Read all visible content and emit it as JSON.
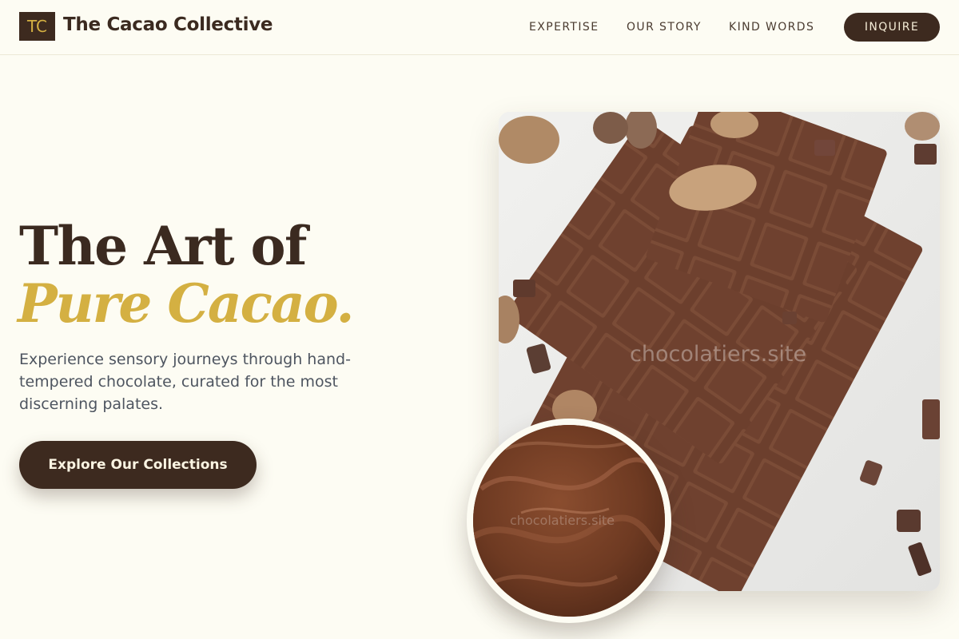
{
  "header": {
    "logo_mark": "TC",
    "brand_name": "The Cacao Collective",
    "nav": [
      {
        "label": "EXPERTISE"
      },
      {
        "label": "OUR STORY"
      },
      {
        "label": "KIND WORDS"
      }
    ],
    "inquire_label": "INQUIRE"
  },
  "hero": {
    "headline_line1": "The Art of",
    "headline_line2": "Pure Cacao.",
    "subtext": "Experience sensory journeys through hand-tempered chocolate, curated for the most discerning palates.",
    "cta_label": "Explore Our Collections"
  },
  "images": {
    "watermark_text": "chocolatiers.site"
  },
  "colors": {
    "background": "#fdfcf3",
    "primary_brown": "#3d2a1f",
    "accent_gold": "#d4b042",
    "body_text": "#4e5560"
  }
}
